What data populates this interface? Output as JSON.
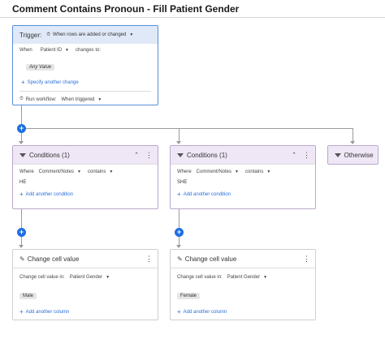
{
  "header": {
    "title": "Comment Contains Pronoun - Fill Patient Gender"
  },
  "trigger": {
    "label": "Trigger:",
    "event": "When rows are added or changed",
    "when_label": "When",
    "column": "Patient ID",
    "changes_to_label": "changes to:",
    "value": "Any Value",
    "specify_link": "Specify another change",
    "run_label": "Run workflow:",
    "run_value": "When triggered"
  },
  "conditions": [
    {
      "title": "Conditions (1)",
      "where_label": "Where",
      "column": "Comment/Notes",
      "operator": "contains",
      "value": "HE",
      "add_link": "Add another condition"
    },
    {
      "title": "Conditions (1)",
      "where_label": "Where",
      "column": "Comment/Notes",
      "operator": "contains",
      "value": "SHE",
      "add_link": "Add another condition"
    }
  ],
  "otherwise": {
    "label": "Otherwise"
  },
  "actions": [
    {
      "title": "Change cell value",
      "label": "Change cell value in:",
      "column": "Patient Gender",
      "value": "Male",
      "add_link": "Add another column"
    },
    {
      "title": "Change cell value",
      "label": "Change cell value in:",
      "column": "Patient Gender",
      "value": "Female",
      "add_link": "Add another column"
    }
  ],
  "colors": {
    "accent_blue": "#1f6fe0",
    "trigger_border": "#5a8fd8",
    "trigger_header": "#dfe9f8",
    "condition_header": "#efe7f6",
    "condition_border": "#b9a8cc",
    "link": "#2a6fdb"
  }
}
